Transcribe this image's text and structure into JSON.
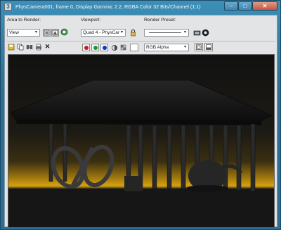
{
  "window": {
    "title": "PhysCamera001, frame 0, Display Gamma: 2.2, RGBA Color 32 Bits/Channel (1:1)",
    "app_icon_glyph": "3"
  },
  "toolbar": {
    "area_to_render_label": "Area to Render:",
    "area_to_render_value": "View",
    "viewport_label": "Viewport:",
    "viewport_value": "Quad 4 - PhysCar",
    "render_preset_label": "Render Preset:",
    "render_preset_value": "",
    "channel_value": "RGB Alpha"
  },
  "icons": {
    "minimize": "minimize-icon",
    "maximize": "maximize-icon",
    "close": "close-icon",
    "save": "save-icon",
    "copy": "copy-icon",
    "clone": "clone-window-icon",
    "print": "print-icon",
    "clear": "clear-icon",
    "lock": "lock-icon"
  },
  "colors": {
    "red_channel": "#d31515",
    "green_channel": "#159c2a",
    "blue_channel": "#1733c9",
    "sky_glow": "#d8a20e",
    "titlebar": "#2f78a2"
  }
}
